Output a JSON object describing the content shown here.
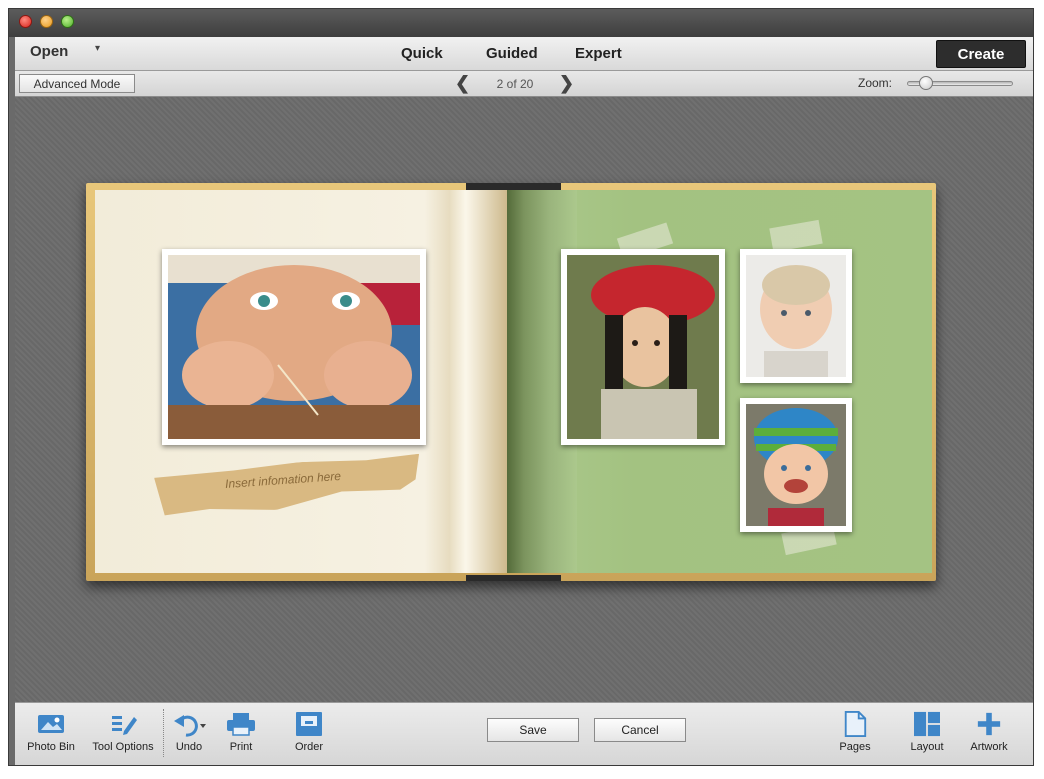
{
  "window": {
    "close": "close",
    "minimize": "minimize",
    "maximize": "maximize"
  },
  "modebar": {
    "open_label": "Open",
    "tabs": [
      "Quick",
      "Guided",
      "Expert"
    ],
    "create_label": "Create"
  },
  "optbar": {
    "advanced_mode_label": "Advanced Mode",
    "page_indicator": "2 of 20",
    "zoom_label": "Zoom:",
    "zoom_level": 0.2
  },
  "book": {
    "caption_placeholder": "Insert infomation here"
  },
  "bottombar": {
    "photo_bin": "Photo Bin",
    "tool_options": "Tool Options",
    "undo": "Undo",
    "print": "Print",
    "order": "Order",
    "save": "Save",
    "cancel": "Cancel",
    "pages": "Pages",
    "layout": "Layout",
    "artwork": "Artwork"
  },
  "colors": {
    "accent_icon": "#3f86c8",
    "create_bg": "#2d2d2d",
    "canvas_bg": "#6b6b6b"
  }
}
